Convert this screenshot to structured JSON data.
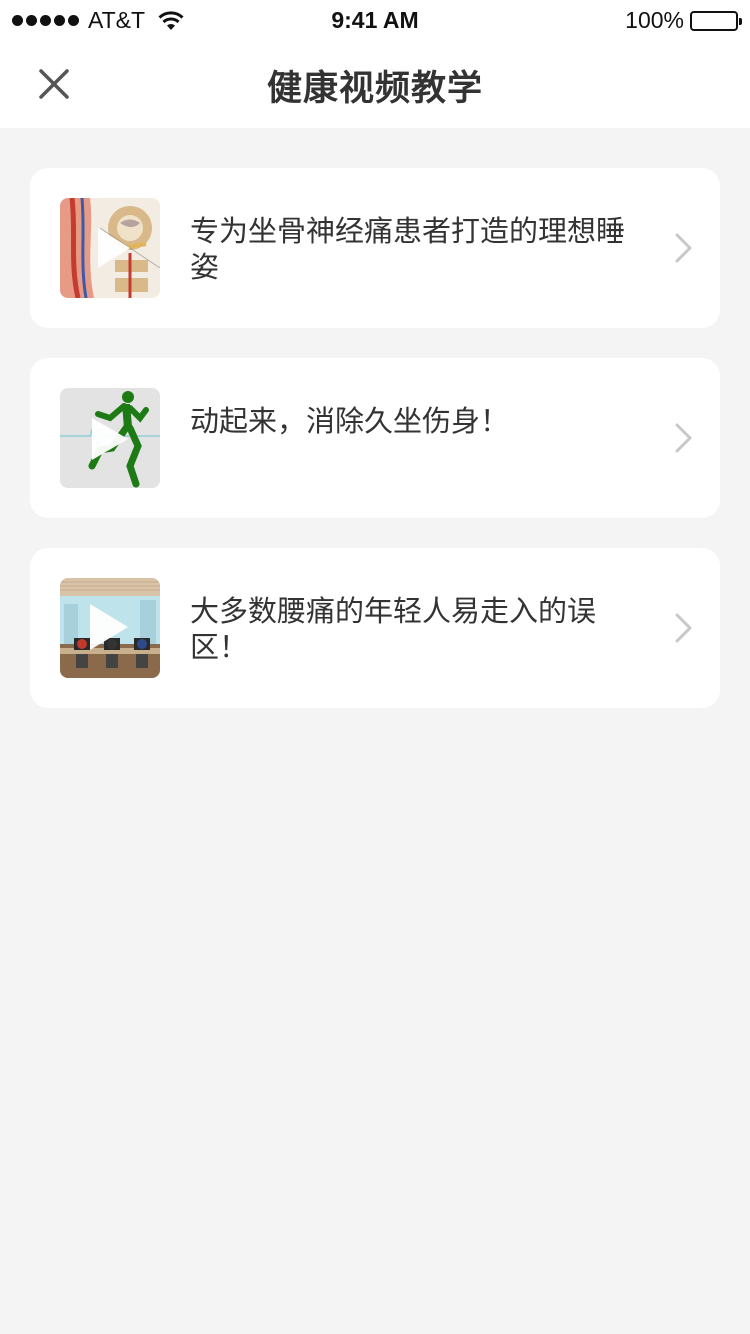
{
  "status_bar": {
    "carrier": "AT&T",
    "time": "9:41 AM",
    "battery": "100%"
  },
  "nav": {
    "title": "健康视频教学",
    "close_icon": "close-icon"
  },
  "videos": [
    {
      "title": "专为坐骨神经痛患者打造的理想睡姿",
      "thumbnail": "spine-anatomy-thumbnail"
    },
    {
      "title": "动起来，消除久坐伤身！",
      "thumbnail": "running-figure-thumbnail"
    },
    {
      "title": "大多数腰痛的年轻人易走入的误区！",
      "thumbnail": "office-workers-thumbnail"
    }
  ],
  "colors": {
    "background": "#f4f4f4",
    "card": "#ffffff",
    "text": "#333333",
    "chevron": "#c8c8c8"
  }
}
